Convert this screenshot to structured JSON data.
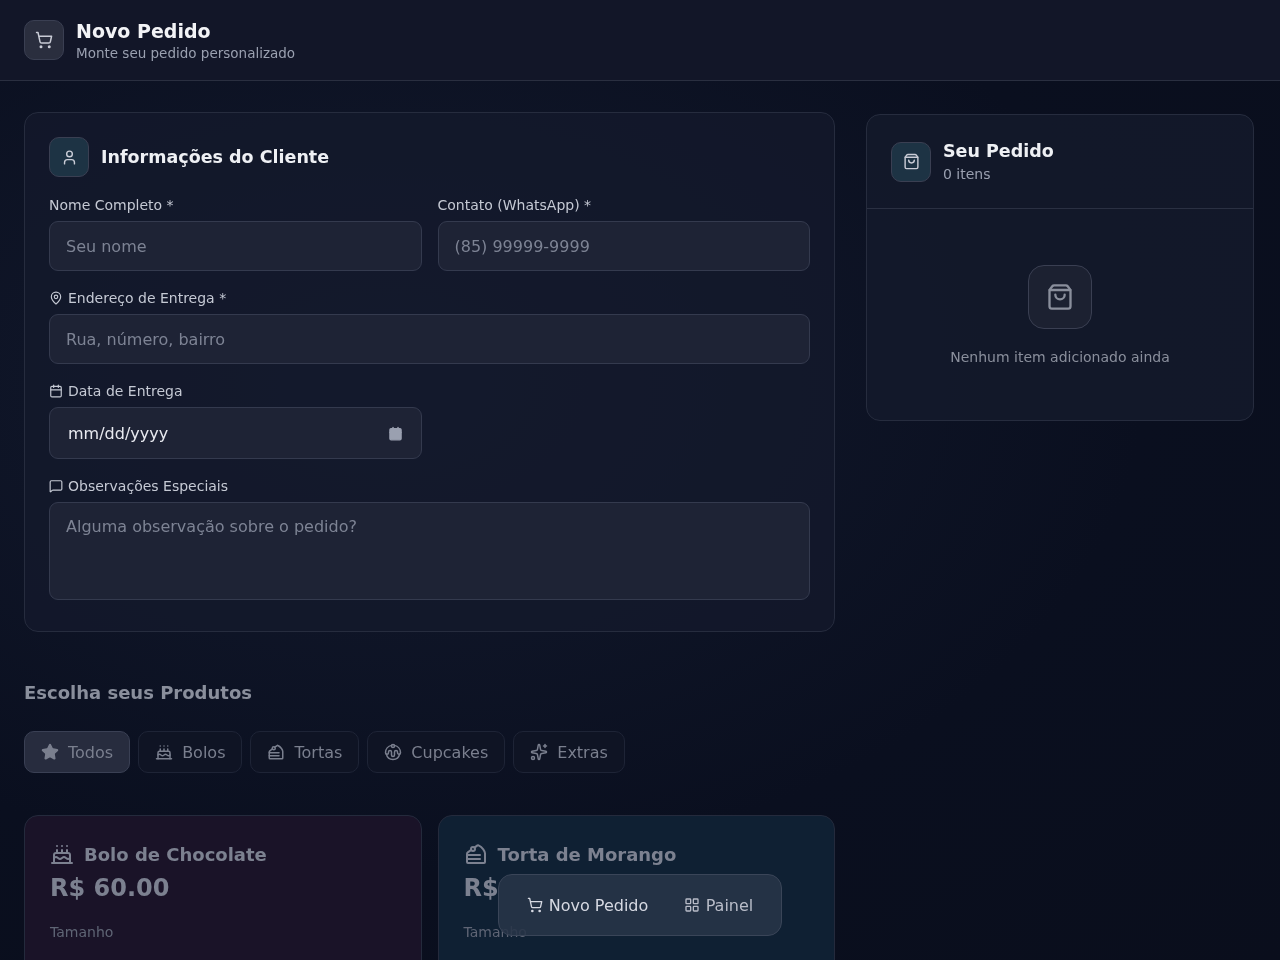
{
  "header": {
    "title": "Novo Pedido",
    "subtitle": "Monte seu pedido personalizado"
  },
  "customer": {
    "title": "Informações do Cliente",
    "fields": [
      {
        "kind": "text",
        "label": "Nome Completo *",
        "placeholder": "Seu nome"
      },
      {
        "kind": "text",
        "label": "Contato (WhatsApp) *",
        "placeholder": "(85) 99999-9999"
      },
      {
        "kind": "text",
        "label": "Endereço de Entrega *",
        "placeholder": "Rua, número, bairro"
      },
      {
        "kind": "date",
        "label": "Data de Entrega",
        "value": "mm/dd/yyyy"
      },
      {
        "kind": "textarea",
        "label": "Observações Especiais",
        "placeholder": "Alguma observação sobre o pedido?"
      }
    ]
  },
  "products": {
    "title": "Escolha seus Produtos",
    "filters": [
      {
        "label": "Todos",
        "selected": true
      },
      {
        "label": "Bolos",
        "selected": false
      },
      {
        "label": "Tortas",
        "selected": false
      },
      {
        "label": "Cupcakes",
        "selected": false
      },
      {
        "label": "Extras",
        "selected": false
      }
    ],
    "items": [
      {
        "name": "Bolo de Chocolate",
        "price": "R$ 60.00",
        "size_label": "Tamanho",
        "color": "#1a1328"
      },
      {
        "name": "Torta de Morango",
        "price": "R$",
        "size_label": "Tamanho",
        "color": "#0f2033"
      }
    ]
  },
  "order": {
    "title": "Seu Pedido",
    "count": "0 itens",
    "empty_text": "Nenhum item adicionado ainda"
  },
  "bottom_nav": [
    {
      "label": "Novo Pedido",
      "selected": true
    },
    {
      "label": "Painel",
      "selected": false
    }
  ]
}
